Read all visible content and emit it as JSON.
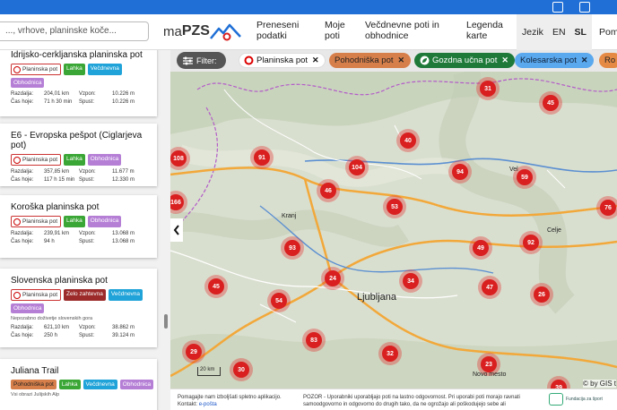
{
  "search": {
    "placeholder": "..., vrhove, planinske koče..."
  },
  "logo": {
    "prefix": "ma",
    "brand": "PZS"
  },
  "nav": [
    {
      "label": "Preneseni podatki"
    },
    {
      "label": "Moje poti"
    },
    {
      "label": "Večdnevne poti in obhodnice"
    },
    {
      "label": "Legenda karte"
    }
  ],
  "language": {
    "label": "Jezik",
    "options": [
      "EN",
      "SL"
    ],
    "selected": "SL"
  },
  "help": {
    "label": "Pomo"
  },
  "filter": {
    "button_label": "Filter:",
    "chips": [
      {
        "label": "Planinska pot",
        "bg": "#ffffff",
        "fg": "#111111",
        "border": "#dddddd"
      },
      {
        "label": "Pohodniška pot",
        "bg": "#d77f4a",
        "fg": "#222222",
        "border": "#d77f4a"
      },
      {
        "label": "Gozdna učna pot",
        "bg": "#1f7a3a",
        "fg": "#ffffff",
        "border": "#1f7a3a"
      },
      {
        "label": "Kolesarska pot",
        "bg": "#5aa8ee",
        "fg": "#10233a",
        "border": "#5aa8ee"
      },
      {
        "label": "Ro",
        "bg": "#e58a45",
        "fg": "#222222",
        "border": "#e58a45"
      }
    ]
  },
  "routes": [
    {
      "title": "Idrijsko-cerkljanska planinska pot",
      "tags": [
        {
          "label": "Planinska pot",
          "kind": "plan"
        },
        {
          "label": "Lahka",
          "kind": "lah"
        },
        {
          "label": "Večdnevna",
          "kind": "vec"
        },
        {
          "label": "Obhodnica",
          "kind": "obh"
        }
      ],
      "description": "",
      "distance_label": "Razdalja:",
      "distance": "204,01 km",
      "time_label": "Čas hoje:",
      "time": "71 h 30 min",
      "ascent_label": "Vzpon:",
      "ascent": "10.226 m",
      "descent_label": "Spust:",
      "descent": "10.226 m"
    },
    {
      "title": "E6 - Evropska pešpot (Ciglarjeva pot)",
      "tags": [
        {
          "label": "Planinska pot",
          "kind": "plan"
        },
        {
          "label": "Lahka",
          "kind": "lah"
        },
        {
          "label": "Obhodnica",
          "kind": "obh"
        }
      ],
      "description": "",
      "distance_label": "Razdalja:",
      "distance": "357,85 km",
      "time_label": "Čas hoje:",
      "time": "117 h 15 min",
      "ascent_label": "Vzpon:",
      "ascent": "11.677 m",
      "descent_label": "Spust:",
      "descent": "12.330 m"
    },
    {
      "title": "Koroška planinska pot",
      "tags": [
        {
          "label": "Planinska pot",
          "kind": "plan"
        },
        {
          "label": "Lahka",
          "kind": "lah"
        },
        {
          "label": "Obhodnica",
          "kind": "obh"
        }
      ],
      "description": "",
      "distance_label": "Razdalja:",
      "distance": "239,91 km",
      "time_label": "Čas hoje:",
      "time": "94 h",
      "ascent_label": "Vzpon:",
      "ascent": "13.068 m",
      "descent_label": "Spust:",
      "descent": "13.068 m"
    },
    {
      "title": "Slovenska planinska pot",
      "tags": [
        {
          "label": "Planinska pot",
          "kind": "plan"
        },
        {
          "label": "Zelo zahtevna",
          "kind": "zel"
        },
        {
          "label": "Večdnevna",
          "kind": "vec"
        },
        {
          "label": "Obhodnica",
          "kind": "obh"
        }
      ],
      "description": "Nepozabno doživetje slovenskih gora",
      "distance_label": "Razdalja:",
      "distance": "621,10 km",
      "time_label": "Čas hoje:",
      "time": "250 h",
      "ascent_label": "Vzpon:",
      "ascent": "38.862 m",
      "descent_label": "Spust:",
      "descent": "39.124 m"
    },
    {
      "title": "Juliana Trail",
      "tags": [
        {
          "label": "Pohodniška pot",
          "kind": "poh"
        },
        {
          "label": "Lahka",
          "kind": "lah"
        },
        {
          "label": "Večdnevna",
          "kind": "vec"
        },
        {
          "label": "Obhodnica",
          "kind": "obh"
        }
      ],
      "description": "Vsi obrazi Julijskih Alp",
      "distance_label": "",
      "distance": "",
      "time_label": "",
      "time": "",
      "ascent_label": "",
      "ascent": "",
      "descent_label": "",
      "descent": ""
    }
  ],
  "map": {
    "clusters": [
      "31",
      "45",
      "40",
      "91",
      "104",
      "94",
      "59",
      "108",
      "46",
      "166",
      "53",
      "76",
      "93",
      "49",
      "92",
      "24",
      "34",
      "45",
      "54",
      "47",
      "26",
      "83",
      "29",
      "30",
      "32",
      "23",
      "39"
    ],
    "towns": [
      "Kranj",
      "Celje",
      "Novo mesto",
      "Vel"
    ],
    "capital": "Ljubljana",
    "scale_label": "20 km",
    "credit": "© by GIS t"
  },
  "footer": {
    "left_line1": "Pomagajte nam izboljšati spletno aplikacijo.",
    "contact_label": "Kontakt:",
    "contact_link": "e-pošta",
    "disclaimer": "POZOR - Uporabniki uporabljajo poti na lastno odgovornost. Pri uporabi poti morajo ravnati samoodgovorno in odgovorno do drugih tako, da ne ogrožajo ali poškodujejo sebe ali",
    "fund_label": "Fundacija za šport"
  },
  "colors": {
    "cluster": "#d91f1f",
    "accent": "#1f6fd6",
    "map_road": "#f2a83a",
    "map_border": "#b35cc8"
  }
}
